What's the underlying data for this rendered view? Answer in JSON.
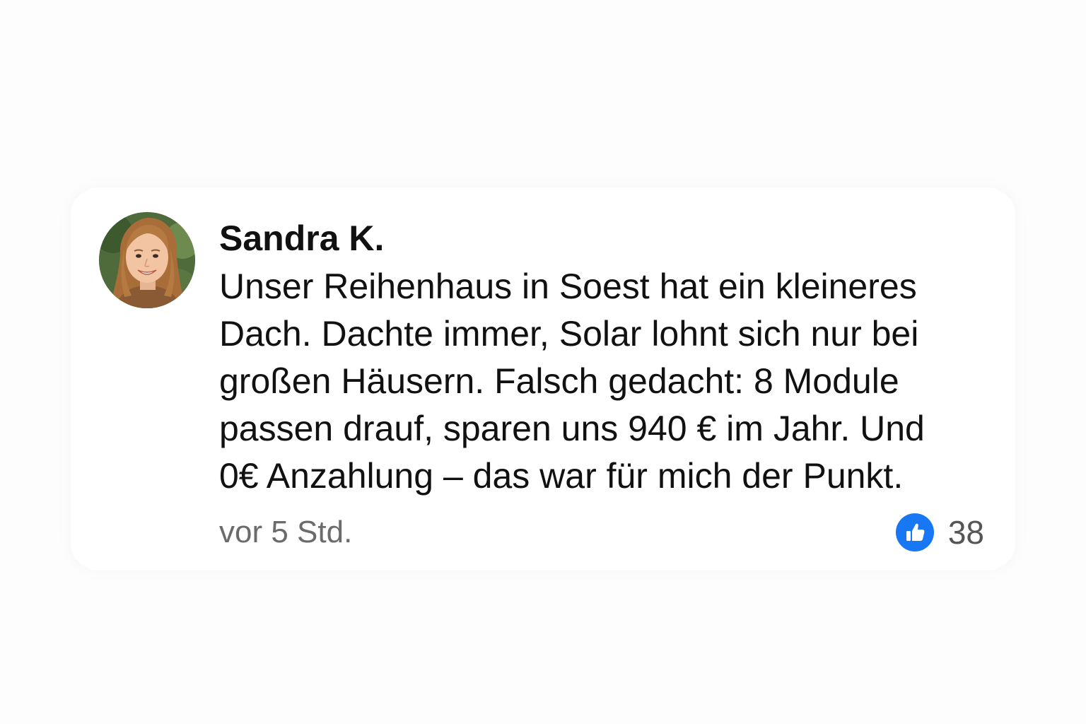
{
  "comment": {
    "author": "Sandra K.",
    "text_lines": [
      "Unser Reihenhaus in Soest hat ein kleineres",
      "Dach. Dachte immer, Solar lohnt sich nur bei",
      "großen Häusern. Falsch gedacht: 8 Module",
      "passen drauf, sparen uns 940 € im Jahr. Und",
      "0€ Anzahlung – das war für mich der Punkt."
    ],
    "timestamp": "vor 5 Std.",
    "like_count": "38",
    "like_icon": "thumbs-up-icon",
    "avatar_icon": "user-avatar-photo"
  },
  "colors": {
    "background": "#fdfdfd",
    "card": "#ffffff",
    "like_accent": "#1877f2",
    "muted_text": "#6b6b6b"
  }
}
